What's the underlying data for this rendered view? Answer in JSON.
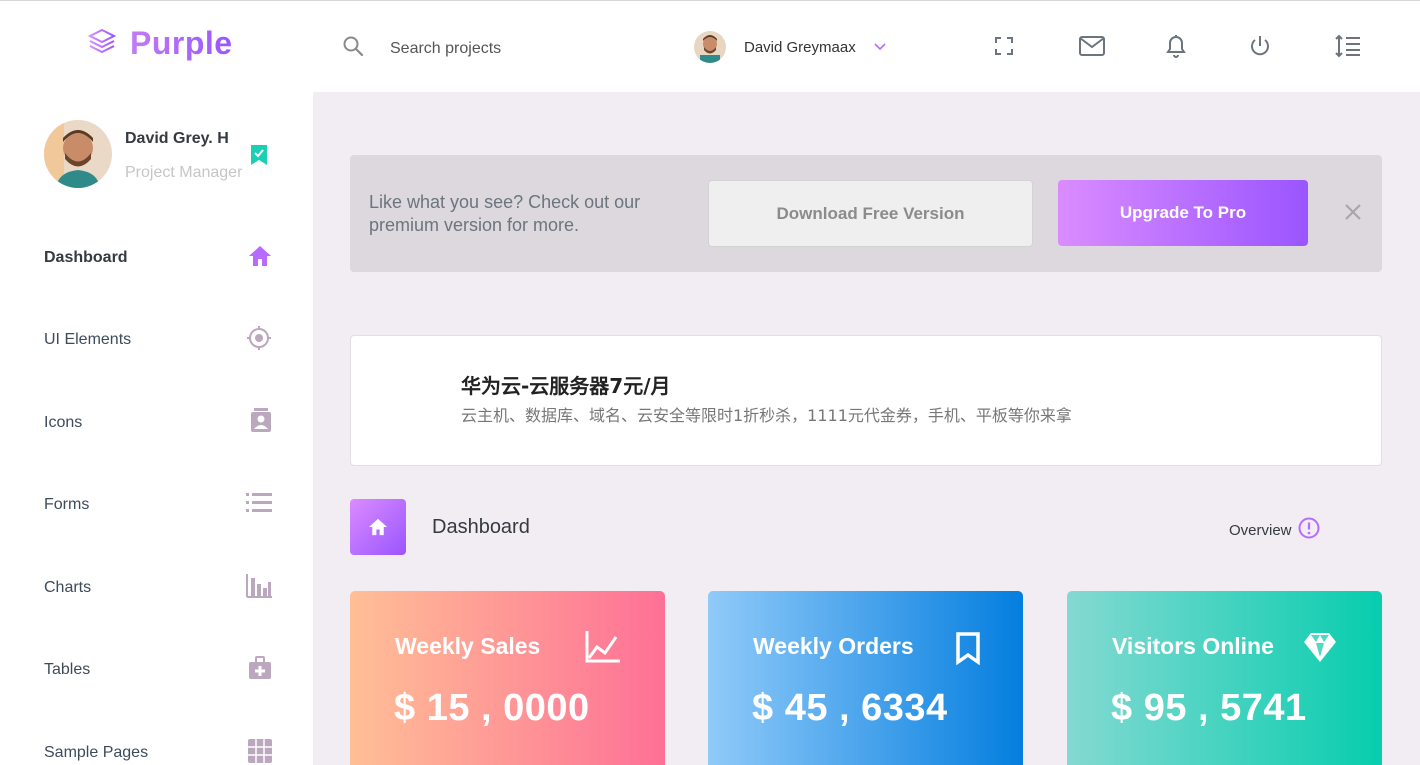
{
  "brand": {
    "name": "Purple"
  },
  "navbar": {
    "search_placeholder": "Search projects",
    "user_name": "David Greymaax"
  },
  "sidebar": {
    "profile": {
      "name": "David Grey. H",
      "role": "Project Manager"
    },
    "items": [
      {
        "label": "Dashboard",
        "icon": "home-icon",
        "active": true
      },
      {
        "label": "UI Elements",
        "icon": "crosshair-icon",
        "active": false
      },
      {
        "label": "Icons",
        "icon": "contacts-icon",
        "active": false
      },
      {
        "label": "Forms",
        "icon": "list-icon",
        "active": false
      },
      {
        "label": "Charts",
        "icon": "bar-chart-icon",
        "active": false
      },
      {
        "label": "Tables",
        "icon": "medical-bag-icon",
        "active": false
      },
      {
        "label": "Sample Pages",
        "icon": "grid-icon",
        "active": false
      }
    ]
  },
  "banner": {
    "text": "Like what you see? Check out our premium version for more.",
    "free_button": "Download Free Version",
    "pro_button": "Upgrade To Pro"
  },
  "ad": {
    "title": "华为云-云服务器7元/月",
    "subtitle": "云主机、数据库、域名、云安全等限时1折秒杀，1111元代金券，手机、平板等你来拿"
  },
  "page_header": {
    "title": "Dashboard",
    "overview": "Overview"
  },
  "stats": [
    {
      "title": "Weekly Sales",
      "value": "$ 15 , 0000",
      "icon": "chart-line-icon"
    },
    {
      "title": "Weekly Orders",
      "value": "$ 45 , 6334",
      "icon": "bookmark-icon"
    },
    {
      "title": "Visitors Online",
      "value": "$ 95 , 5741",
      "icon": "diamond-icon"
    }
  ],
  "colors": {
    "accent": "#b66dff",
    "background": "#f2edf3",
    "card_red": [
      "#ffbf96",
      "#fe7096"
    ],
    "card_blue": [
      "#90caf9",
      "#047edf"
    ],
    "card_green": [
      "#84d9d2",
      "#07cdae"
    ]
  }
}
